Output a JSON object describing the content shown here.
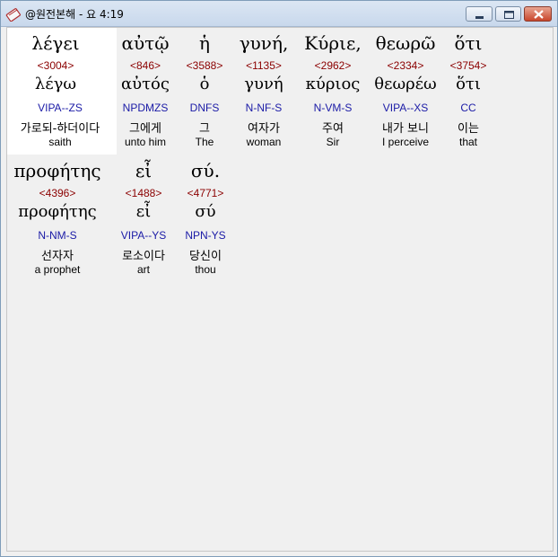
{
  "window": {
    "title": "@원전본해 - 요 4:19"
  },
  "words": [
    {
      "greek": "λέγει",
      "strong": "<3004>",
      "lemma": "λέγω",
      "morph": "VIPA--ZS",
      "korean": "가로되-하더이다",
      "english": "saith"
    },
    {
      "greek": "αὐτῷ",
      "strong": "<846>",
      "lemma": "αὐτός",
      "morph": "NPDMZS",
      "korean": "그에게",
      "english": "unto him"
    },
    {
      "greek": "ἡ",
      "strong": "<3588>",
      "lemma": "ὁ",
      "morph": "DNFS",
      "korean": "그",
      "english": "The"
    },
    {
      "greek": "γυνή,",
      "strong": "<1135>",
      "lemma": "γυνή",
      "morph": "N-NF-S",
      "korean": "여자가",
      "english": "woman"
    },
    {
      "greek": "Κύριε,",
      "strong": "<2962>",
      "lemma": "κύριος",
      "morph": "N-VM-S",
      "korean": "주여",
      "english": "Sir"
    },
    {
      "greek": "θεωρῶ",
      "strong": "<2334>",
      "lemma": "θεωρέω",
      "morph": "VIPA--XS",
      "korean": "내가 보니",
      "english": "I perceive"
    },
    {
      "greek": "ὅτι",
      "strong": "<3754>",
      "lemma": "ὅτι",
      "morph": "CC",
      "korean": "이는",
      "english": "that"
    },
    {
      "greek": "προφήτης",
      "strong": "<4396>",
      "lemma": "προφήτης",
      "morph": "N-NM-S",
      "korean": "선자자",
      "english": "a prophet"
    },
    {
      "greek": "εἶ",
      "strong": "<1488>",
      "lemma": "εἶ",
      "morph": "VIPA--YS",
      "korean": "로소이다",
      "english": "art"
    },
    {
      "greek": "σύ.",
      "strong": "<4771>",
      "lemma": "σύ",
      "morph": "NPN-YS",
      "korean": "당신이",
      "english": "thou"
    }
  ]
}
